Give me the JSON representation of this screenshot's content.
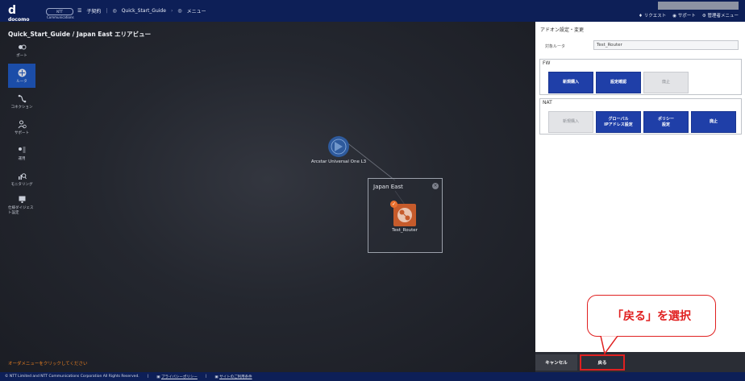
{
  "header": {
    "logo_top": "docomo",
    "logo_bottom": "business",
    "ntt_badge": "NTT Communications",
    "crumbs": [
      "子契約",
      "Quick_Start_Guide",
      "メニュー"
    ],
    "links": [
      "リクエスト",
      "サポート",
      "管理者メニュー"
    ]
  },
  "canvas": {
    "title": "Quick_Start_Guide / Japan East エリアビュー",
    "nav": [
      {
        "label": "ポート",
        "active": false
      },
      {
        "label": "ルータ",
        "active": true
      },
      {
        "label": "コネクション",
        "active": false
      },
      {
        "label": "サポート",
        "active": false
      },
      {
        "label": "運用",
        "active": false
      },
      {
        "label": "モニタリング",
        "active": false
      },
      {
        "label": "仕様ダイジェスト設定",
        "active": false
      }
    ],
    "l3_node_label": "Arcstar Universal One L3",
    "area_name": "Japan East",
    "router_label": "Test_Router",
    "hint": "オーダメニューをクリックしてください"
  },
  "panel": {
    "title": "アドオン設定・変更",
    "target_label": "対象ルータ",
    "target_value": "Test_Router",
    "fw": {
      "title": "FW",
      "buttons": [
        "新規購入",
        "設定確認",
        "廃止"
      ]
    },
    "nat": {
      "title": "NAT",
      "buttons": [
        "新規購入",
        "グローバル\nIPアドレス設定",
        "ポリシー\n設定",
        "廃止"
      ]
    },
    "cancel_label": "キャンセル",
    "back_label": "戻る"
  },
  "callout": "「戻る」を選択",
  "footer": {
    "copyright": "© NTT Limited and NTT Communications Corporation All Rights Reserved.",
    "privacy": "プライバシーポリシー",
    "terms": "サイトのご利用条件"
  },
  "colors": {
    "primary": "#1f3fa8",
    "header": "#0d1f57",
    "accent": "#e02020",
    "router": "#c65b2b"
  }
}
